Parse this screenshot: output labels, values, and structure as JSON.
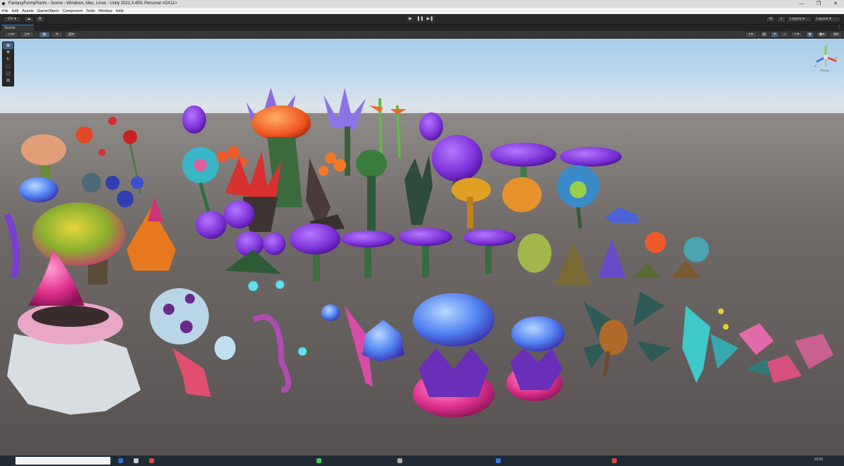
{
  "window": {
    "title": "FantasyFunnyPlants - Scene - Windows, Mac, Linux - Unity 2021.3.45f1 Personal <DX11>",
    "app_icon": "unity-icon",
    "buttons": [
      "—",
      "❐",
      "✕"
    ]
  },
  "menu": [
    "File",
    "Edit",
    "Assets",
    "GameObject",
    "Component",
    "Tools",
    "Window",
    "Help"
  ],
  "toolbar": {
    "account": "OV ▾",
    "cloud_icon": "cloud-icon",
    "collab_icon": "collab-icon",
    "play_icon": "▶",
    "pause_icon": "❚❚",
    "step_icon": "▶❚",
    "history_icon": "history-icon",
    "search_icon": "search-icon",
    "layers": "Layers",
    "layout": "Layout"
  },
  "scene_tab": {
    "label": "Scene",
    "menu_icon": "⋮"
  },
  "scene_toolbar": {
    "left_icons": [
      "transform-toggle-icon",
      "pivot-icon",
      "grid-icon",
      "snap-icon",
      "increment-icon"
    ],
    "right_icons": [
      "shading-mode-icon",
      "2d-icon",
      "lighting-icon",
      "audio-icon",
      "effects-icon",
      "hidden-objects-icon",
      "camera-icon",
      "gizmos-icon"
    ]
  },
  "tools": [
    "view-tool-icon",
    "move-tool-icon",
    "rotate-tool-icon",
    "scale-tool-icon",
    "rect-tool-icon",
    "transform-tool-icon"
  ],
  "gizmo": {
    "axes": [
      "y",
      "x",
      "z"
    ],
    "projection": "Persp"
  },
  "taskbar": {
    "clock": "10:02"
  }
}
